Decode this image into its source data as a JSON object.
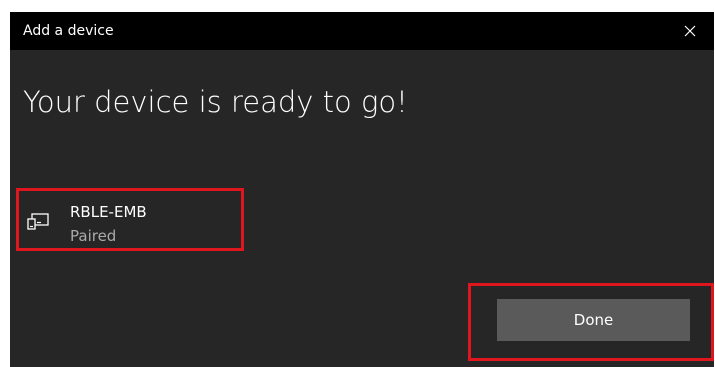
{
  "window": {
    "title": "Add a device",
    "heading": "Your device is ready to go!"
  },
  "titlebar": {
    "close_icon": "close-icon"
  },
  "device": {
    "icon": "device-pc-icon",
    "name": "RBLE-EMB",
    "status": "Paired"
  },
  "actions": {
    "done_label": "Done"
  },
  "colors": {
    "titlebar_bg": "#000000",
    "window_bg": "#262626",
    "button_bg": "#5a5a5a",
    "highlight": "#e0161e",
    "secondary_text": "#aaaaaa"
  }
}
